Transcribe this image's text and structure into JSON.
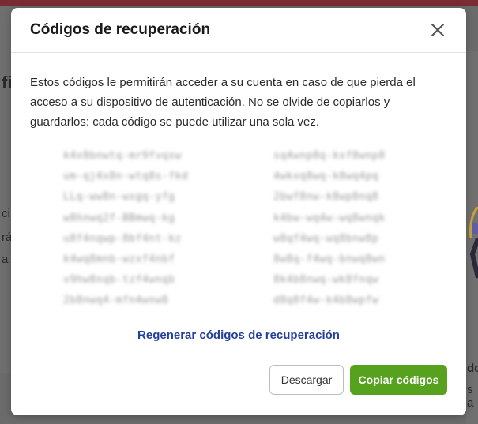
{
  "background": {
    "left_fragments": [
      "fi",
      "ci",
      "rá",
      "a v"
    ],
    "right_fragments": [
      "do",
      "s a"
    ]
  },
  "modal": {
    "title": "Códigos de recuperación",
    "close_icon": "close-icon",
    "description": "Estos códigos le permitirán acceder a su cuenta en caso de que pierda el acceso a su dispositivo de autenticación. No se olvide de copiarlos y guardarlos: cada código se puede utilizar una sola vez.",
    "codes_left": [
      "k4x8bnwtq-mr9fvqsw",
      "um-qj4x8n-wtq8s-fkd",
      "LLq-ww8n-wxgq-yfg",
      "w8hnwq2f-BBmwq-kg",
      "u8f4nqwp-8bf4nt-kz",
      "k4wq8mnb-wzxf4nbf",
      "v9hw8nqb-tzf4wnqb",
      "2b8nwq4-mfn4wnw8"
    ],
    "codes_right": [
      "sq4wnp8q-kxf8wnp8",
      "4wkxq8wq-k8wq4pq",
      "2bwf8nw-k8wp8nq8",
      "k4bw-wq4w-wq8wnqk",
      "w8qf4wq-wq8bnw8p",
      "8w8q-f4wq-bnwq8wn",
      "8k4b8nwq-wk8fnqw",
      "d8q8f4w-k4b8wpfw"
    ],
    "regenerate_link": "Regenerar códigos de recuperación",
    "download_button": "Descargar",
    "copy_button": "Copiar códigos",
    "accent_color": "#56a21e",
    "link_color": "#26419a"
  }
}
